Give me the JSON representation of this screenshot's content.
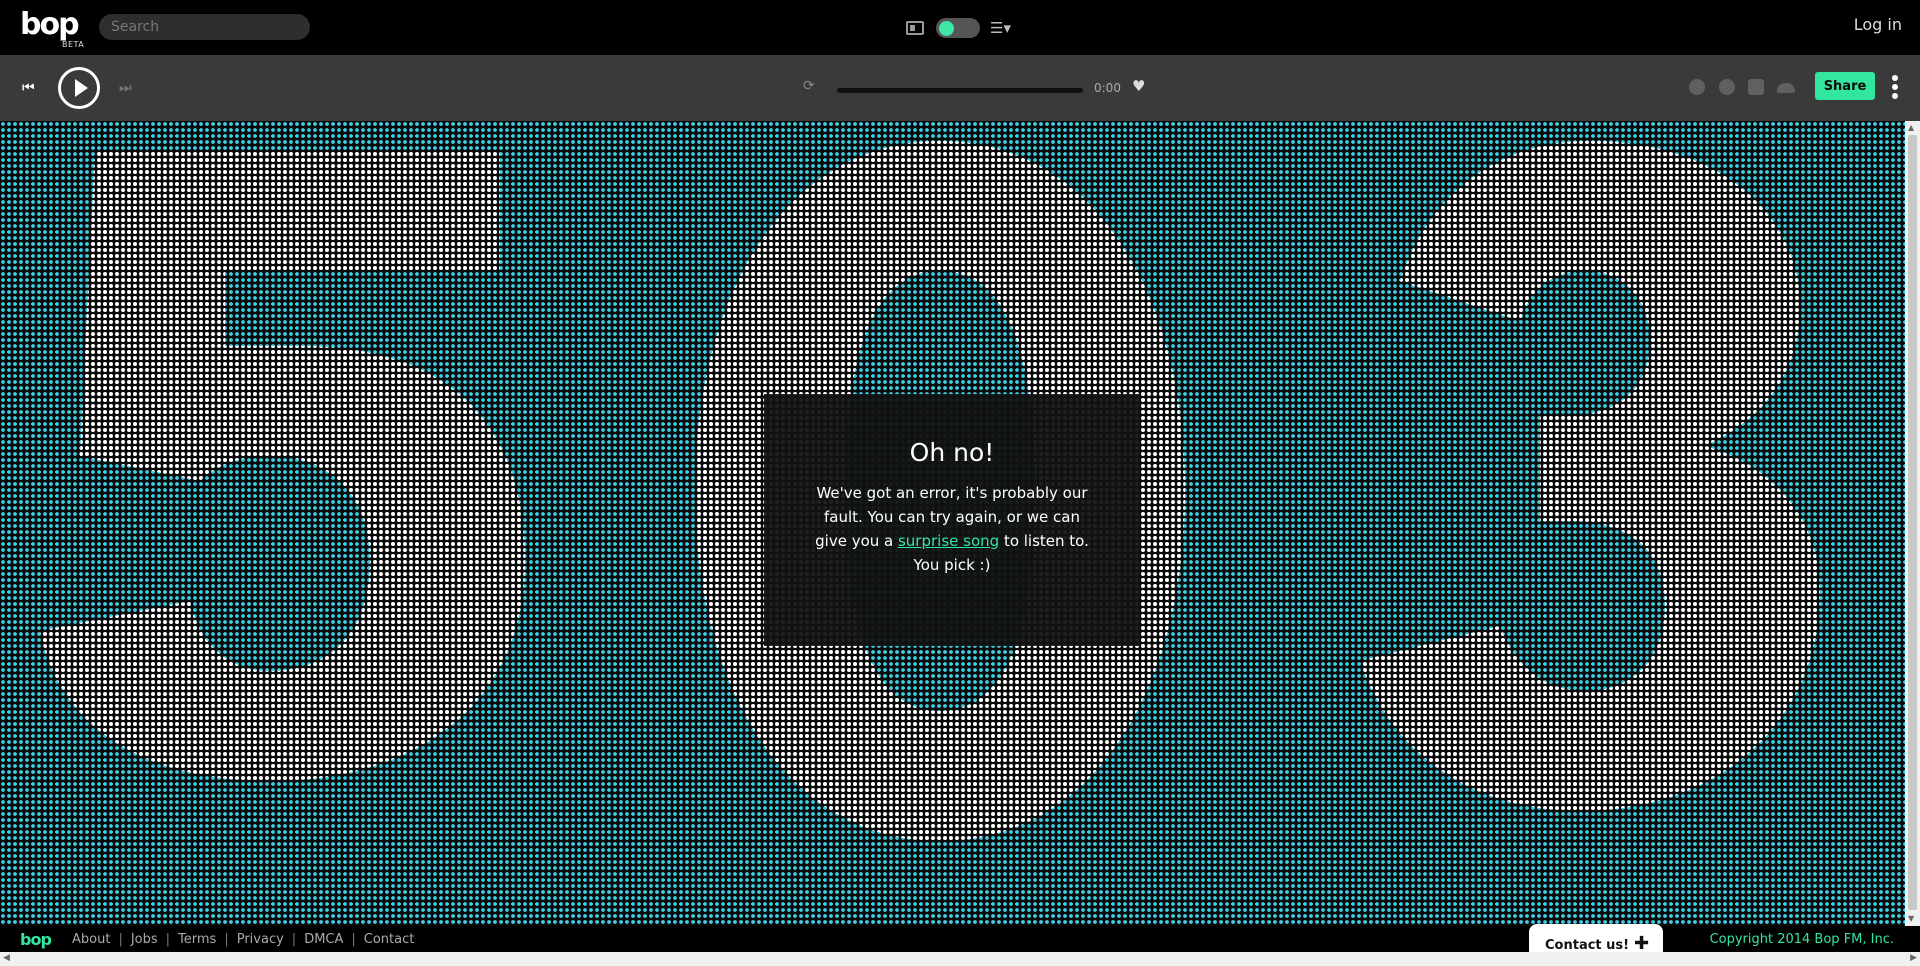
{
  "header": {
    "logo_text": "bop",
    "logo_sub": "BETA",
    "search_placeholder": "Search",
    "login_label": "Log in"
  },
  "player": {
    "time": "0:00",
    "share_label": "Share",
    "progress": 0
  },
  "error": {
    "title": "Oh no!",
    "msg_before": "We've got an error, it's probably our fault. You can try again, or we can give you a ",
    "link_label": "surprise song",
    "msg_after": " to listen to. You pick :)"
  },
  "footer": {
    "logo_text": "bop",
    "links": [
      "About",
      "Jobs",
      "Terms",
      "Privacy",
      "DMCA",
      "Contact"
    ],
    "contact_tab_label": "Contact us!",
    "copyright": "Copyright 2014 Bop FM, Inc."
  },
  "colors": {
    "accent": "#33e6a0",
    "dot_color": "#3bd0e6",
    "header_bg": "#000000",
    "player_bg": "#3a3a3a"
  },
  "icons": {
    "prev": "skip-back-icon",
    "play": "play-icon",
    "next": "skip-forward-icon",
    "repeat": "repeat-icon",
    "favorite": "heart-icon",
    "menu": "vertical-dots-icon"
  }
}
